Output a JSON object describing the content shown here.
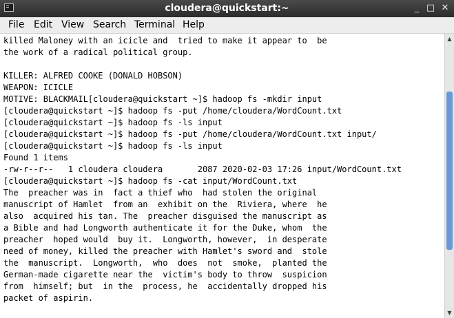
{
  "window": {
    "title": "cloudera@quickstart:~",
    "icon": "terminal-icon",
    "controls": {
      "minimize": "_",
      "maximize": "□",
      "close": "✕"
    }
  },
  "menu": {
    "items": [
      "File",
      "Edit",
      "View",
      "Search",
      "Terminal",
      "Help"
    ]
  },
  "terminal": {
    "lines": [
      "killed Maloney with an icicle and  tried to make it appear to  be",
      "the work of a radical political group.",
      "",
      "KILLER: ALFRED COOKE (DONALD HOBSON)",
      "WEAPON: ICICLE",
      "MOTIVE: BLACKMAIL[cloudera@quickstart ~]$ hadoop fs -mkdir input",
      "[cloudera@quickstart ~]$ hadoop fs -put /home/cloudera/WordCount.txt",
      "[cloudera@quickstart ~]$ hadoop fs -ls input",
      "[cloudera@quickstart ~]$ hadoop fs -put /home/cloudera/WordCount.txt input/",
      "[cloudera@quickstart ~]$ hadoop fs -ls input",
      "Found 1 items",
      "-rw-r--r--   1 cloudera cloudera       2087 2020-02-03 17:26 input/WordCount.txt",
      "[cloudera@quickstart ~]$ hadoop fs -cat input/WordCount.txt",
      "The  preacher was in  fact a thief who  had stolen the original",
      "manuscript of Hamlet  from an  exhibit on the  Riviera, where  he",
      "also  acquired his tan. The  preacher disguised the manuscript as",
      "a Bible and had Longworth authenticate it for the Duke, whom  the",
      "preacher  hoped would  buy it.  Longworth, however,  in desperate",
      "need of money, killed the preacher with Hamlet's sword and  stole",
      "the  manuscript.  Longworth,  who  does  not  smoke,  planted the",
      "German-made cigarette near the  victim's body to throw  suspicion",
      "from  himself; but  in the  process, he  accidentally dropped his",
      "packet of aspirin."
    ]
  },
  "scrollbar": {
    "up_arrow": "▲",
    "down_arrow": "▼",
    "position_fraction": 0.45
  }
}
